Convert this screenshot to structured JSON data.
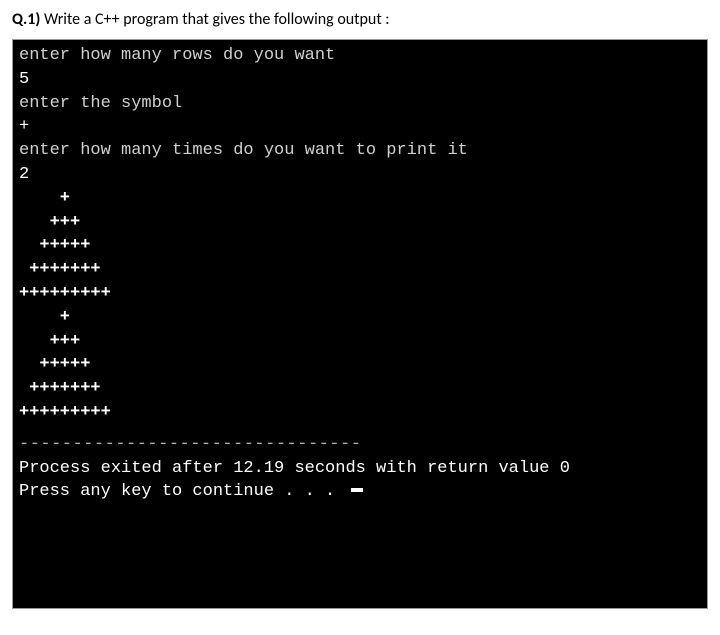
{
  "question": {
    "label": "Q.1)",
    "text": " Write a C++ program that gives the following output :"
  },
  "terminal": {
    "prompt_rows": "enter how many rows do you want",
    "rows_value": "5",
    "prompt_symbol": "enter the symbol",
    "symbol_value": "+",
    "prompt_times": "enter how many times do you want to print it",
    "times_value": "2",
    "pattern": [
      "    +",
      "   +++",
      "  +++++",
      " +++++++",
      "+++++++++",
      "    +",
      "   +++",
      "  +++++",
      " +++++++",
      "+++++++++"
    ],
    "separator": "--------------------------------",
    "exit_line": "Process exited after 12.19 seconds with return value 0",
    "continue_line": "Press any key to continue . . . "
  }
}
